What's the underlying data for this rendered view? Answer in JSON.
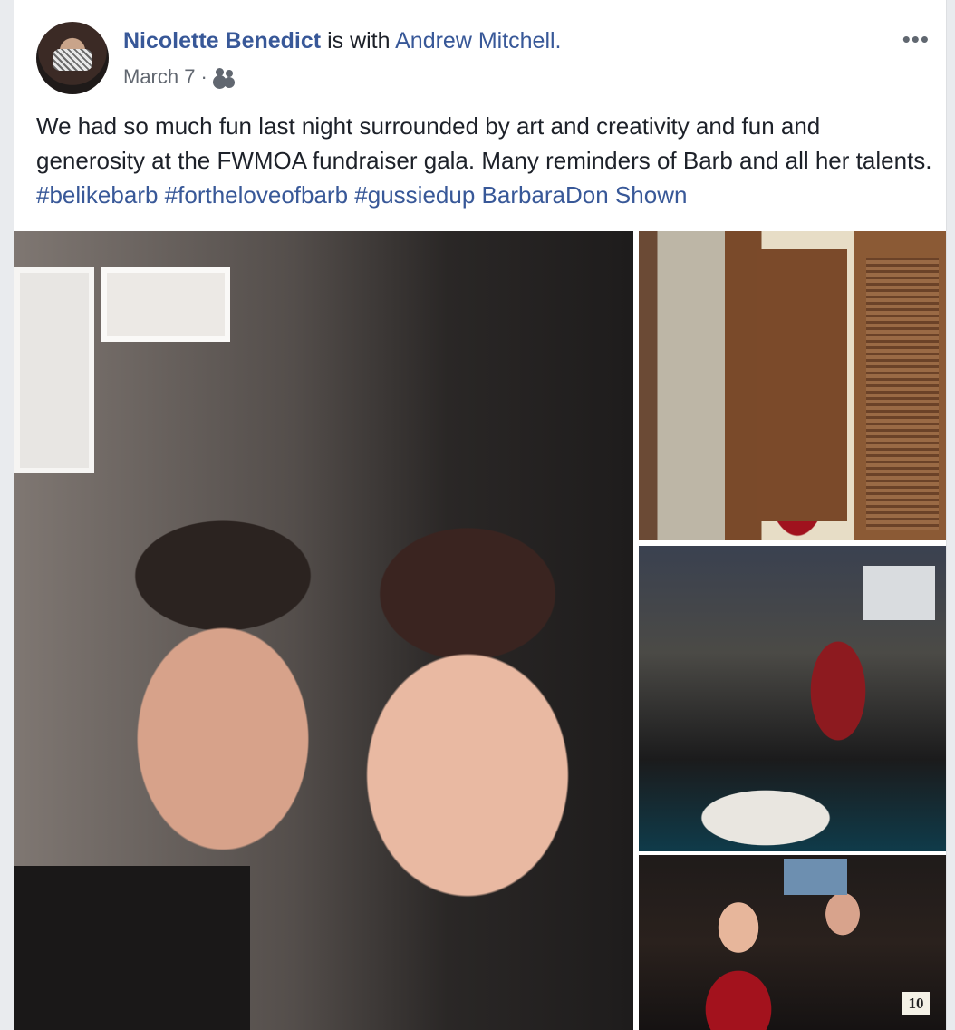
{
  "post": {
    "author": "Nicolette Benedict",
    "with_text": "is with",
    "tagged": "Andrew Mitchell.",
    "date": "March 7",
    "separator": "·",
    "audience_icon": "friends-group-icon",
    "more_label": "•••",
    "text_main": "We had so much fun last night surrounded by art and creativity and fun and generosity at the FWMOA fundraiser gala. Many reminders of Barb and all her talents. ",
    "hashtags": [
      "#belikebarb",
      "#fortheloveofbarb",
      "#gussiedup"
    ],
    "text_links": [
      "BarbaraDon Shown"
    ]
  },
  "photos": {
    "table_number": "10"
  }
}
